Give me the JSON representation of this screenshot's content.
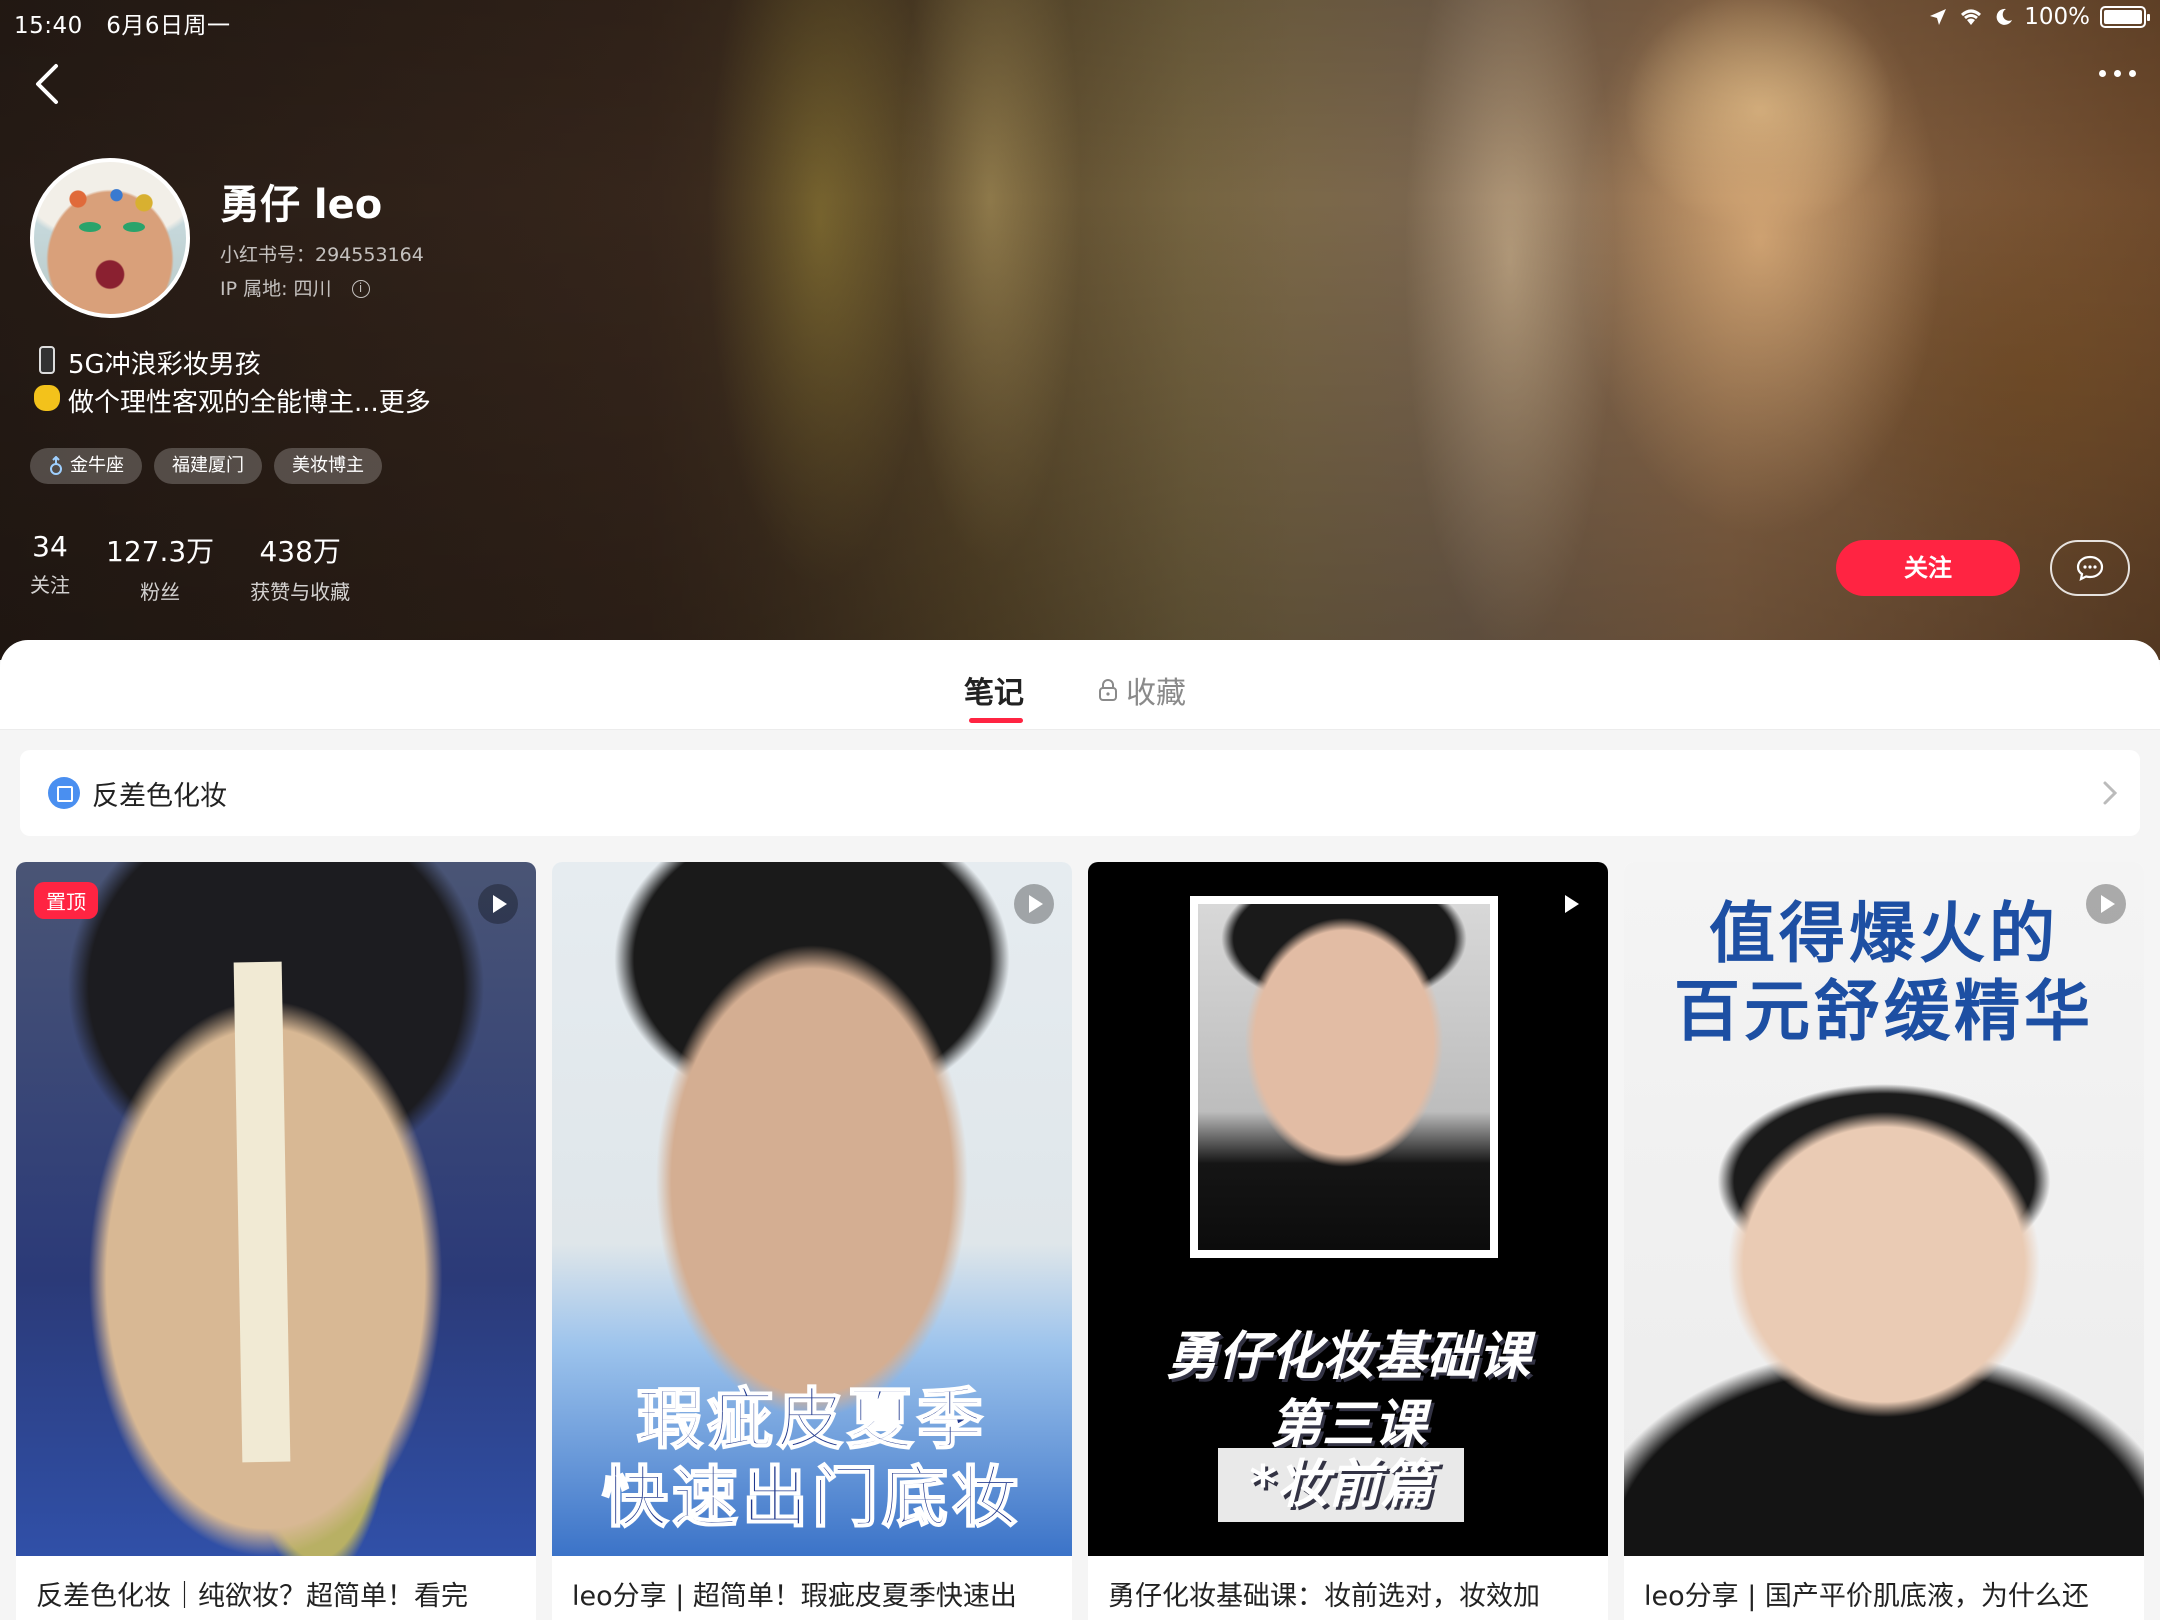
{
  "status_bar": {
    "time": "15:40",
    "date": "6月6日周一",
    "battery": "100%"
  },
  "profile": {
    "name": "勇仔 leo",
    "red_id": "小红书号：294553164",
    "ip_location": "IP 属地: 四川",
    "bio_lines": [
      "5G冲浪彩妆男孩",
      "做个理性客观的全能博主...更多"
    ],
    "tags": [
      "金牛座",
      "福建厦门",
      "美妆博主"
    ],
    "stats": [
      {
        "value": "34",
        "label": "关注"
      },
      {
        "value": "127.3万",
        "label": "粉丝"
      },
      {
        "value": "438万",
        "label": "获赞与收藏"
      }
    ],
    "follow_label": "关注"
  },
  "tabs": {
    "notes": "笔记",
    "collections": "收藏"
  },
  "collection": {
    "title": "反差色化妆"
  },
  "cards": [
    {
      "pinned_label": "置顶",
      "title": "反差色化妆｜纯欲妆？超简单！看完"
    },
    {
      "overlay_lines": [
        "瑕疵皮夏季",
        "快速出门底妆"
      ],
      "title": "leo分享 | 超简单！瑕疵皮夏季快速出"
    },
    {
      "overlay_lines": [
        "勇仔化妆基础课",
        "第三课",
        "*妆前篇"
      ],
      "title": "勇仔化妆基础课：妆前选对，妆效加"
    },
    {
      "overlay_lines": [
        "值得爆火的",
        "百元舒缓精华"
      ],
      "title": "leo分享 | 国产平价肌底液，为什么还"
    }
  ],
  "colors": {
    "accent": "#ff2442",
    "collection_icon": "#4a8ff0"
  }
}
